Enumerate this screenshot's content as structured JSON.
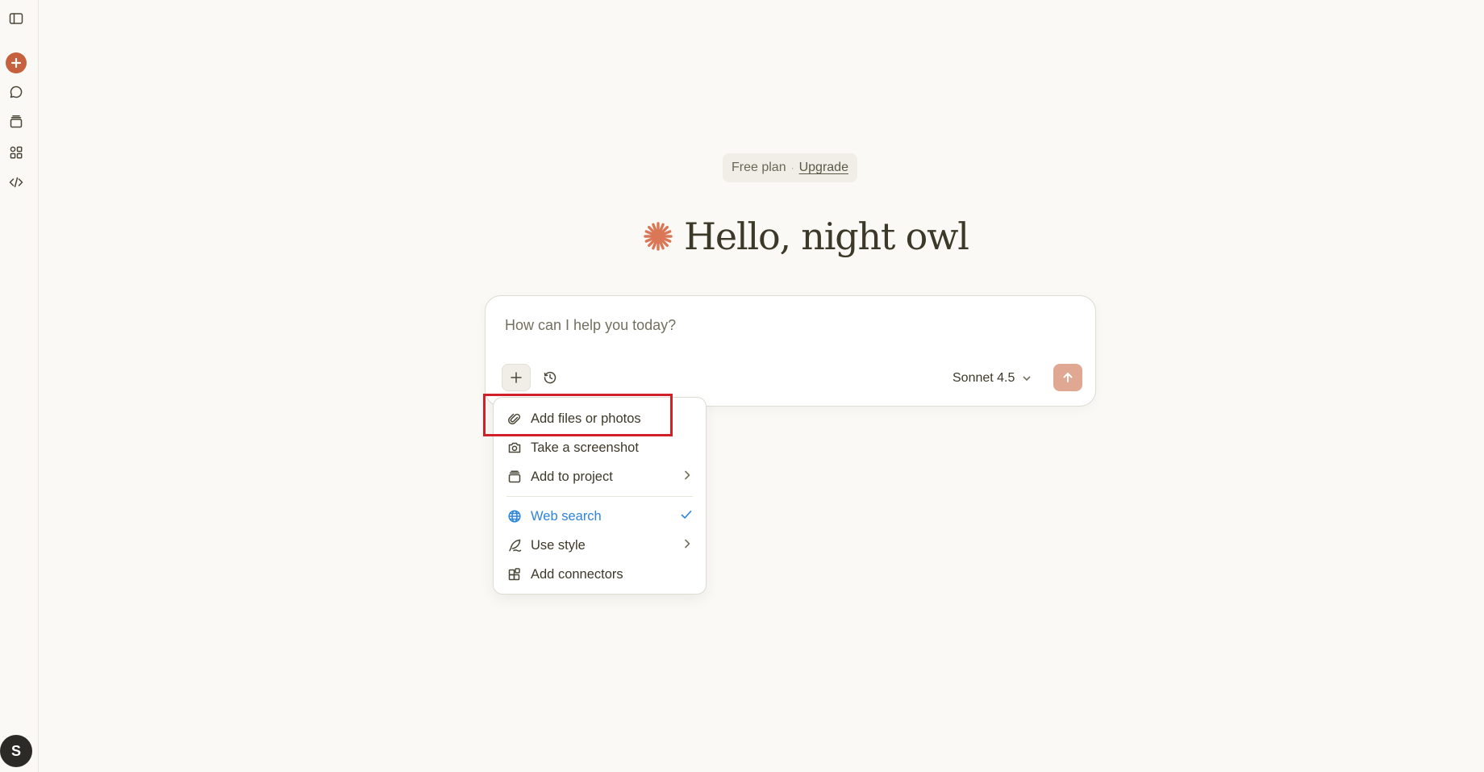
{
  "plan": {
    "label": "Free plan",
    "separator": "·",
    "upgrade": "Upgrade"
  },
  "greeting": {
    "text": "Hello, night owl"
  },
  "composer": {
    "placeholder": "How can I help you today?",
    "model": "Sonnet 4.5"
  },
  "menu": {
    "items": [
      {
        "label": "Add files or photos",
        "icon": "paperclip-icon"
      },
      {
        "label": "Take a screenshot",
        "icon": "camera-icon"
      },
      {
        "label": "Add to project",
        "icon": "project-box-icon",
        "trail": "chevron-right"
      },
      {
        "label": "Web search",
        "icon": "globe-icon",
        "trail": "check",
        "active": true
      },
      {
        "label": "Use style",
        "icon": "feather-pen-icon",
        "trail": "chevron-right"
      },
      {
        "label": "Add connectors",
        "icon": "connectors-icon"
      }
    ]
  },
  "user": {
    "initial": "S"
  },
  "colors": {
    "background": "#faf9f5",
    "accent": "#c6613f",
    "send_button": "#e0a792",
    "active_item": "#2c84db",
    "highlight": "#d1202a"
  }
}
